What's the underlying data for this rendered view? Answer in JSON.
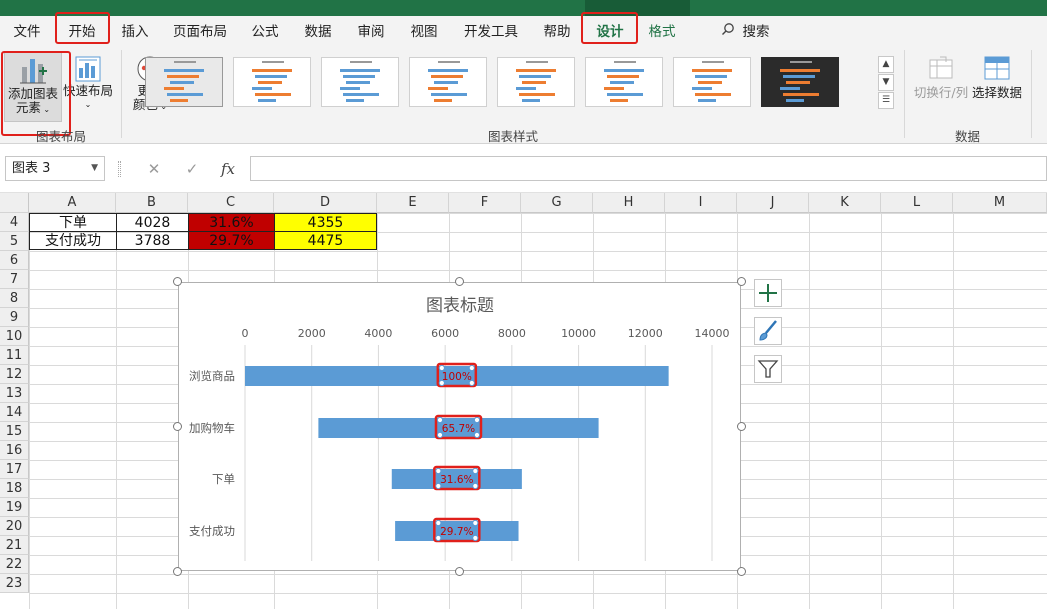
{
  "tabs": [
    {
      "label": "文件"
    },
    {
      "label": "开始"
    },
    {
      "label": "插入"
    },
    {
      "label": "页面布局"
    },
    {
      "label": "公式"
    },
    {
      "label": "数据"
    },
    {
      "label": "审阅"
    },
    {
      "label": "视图"
    },
    {
      "label": "开发工具"
    },
    {
      "label": "帮助"
    },
    {
      "label": "设计"
    },
    {
      "label": "格式"
    }
  ],
  "search_label": "搜索",
  "ribbon": {
    "add_element": {
      "line1": "添加图表",
      "line2": "元素"
    },
    "quick_layout": {
      "line1": "快速布局"
    },
    "change_color": {
      "line1": "更改",
      "line2": "颜色"
    },
    "layout_group": "图表布局",
    "styles_group": "图表样式",
    "switch_row_col": "切换行/列",
    "select_data": "选择数据",
    "data_group": "数据"
  },
  "formula_bar": {
    "name_box": "图表 3",
    "cancel": "✕",
    "enter": "✓",
    "fx": "fx",
    "value": ""
  },
  "columns": [
    "A",
    "B",
    "C",
    "D",
    "E",
    "F",
    "G",
    "H",
    "I",
    "J",
    "K",
    "L",
    "M"
  ],
  "rows": [
    "4",
    "5",
    "6",
    "7",
    "8",
    "9",
    "10",
    "11",
    "12",
    "13",
    "14",
    "15",
    "16",
    "17",
    "18",
    "19",
    "20",
    "21",
    "22",
    "23"
  ],
  "table": [
    {
      "name": "下单",
      "value": "4028",
      "rate": "31.6%",
      "other": "4355"
    },
    {
      "name": "支付成功",
      "value": "3788",
      "rate": "29.7%",
      "other": "4475"
    }
  ],
  "colors": {
    "accent": "#217346",
    "bar": "#5b9bd5",
    "label": "#c00000",
    "highlight_red": "#c00000",
    "highlight_yellow": "#ffff00",
    "annotation": "#e0201b"
  },
  "chart_data": {
    "type": "bar",
    "orientation": "horizontal",
    "title": "图表标题",
    "categories": [
      "浏览商品",
      "加购物车",
      "下单",
      "支付成功"
    ],
    "series": [
      {
        "values": [
          [
            0,
            12700
          ],
          [
            2200,
            10600
          ],
          [
            4400,
            8300
          ],
          [
            4500,
            8200
          ]
        ]
      }
    ],
    "data_labels": [
      "100%",
      "65.7%",
      "31.6%",
      "29.7%"
    ],
    "xlim": [
      0,
      14000
    ],
    "xticks": [
      0,
      2000,
      4000,
      6000,
      8000,
      10000,
      12000,
      14000
    ],
    "x_tick_labels": [
      "0",
      "2000",
      "4000",
      "6000",
      "8000",
      "10000",
      "12000",
      "14000"
    ],
    "axis_position": "top",
    "grid": true
  }
}
